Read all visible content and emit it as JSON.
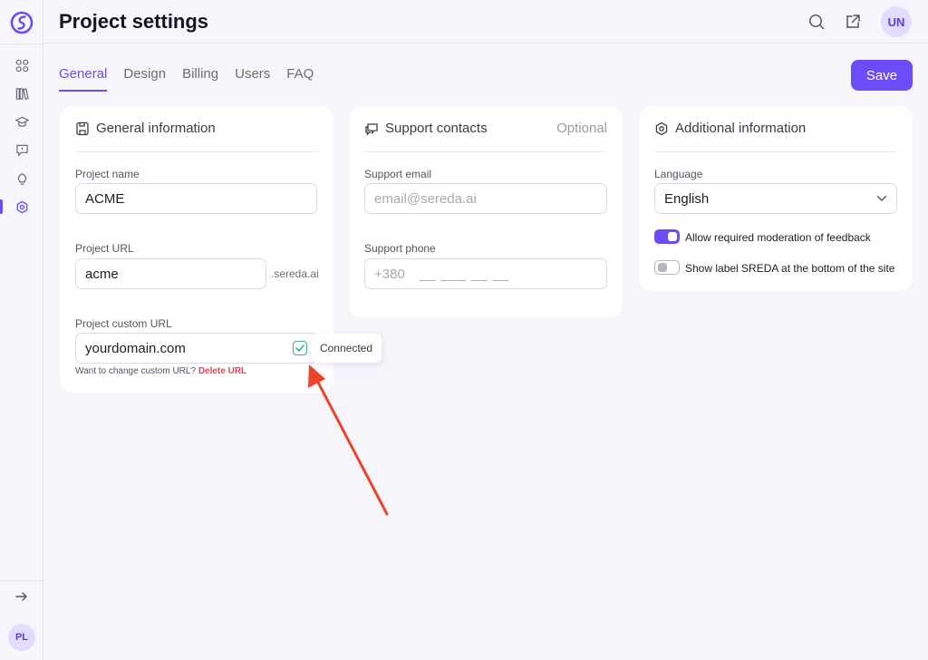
{
  "sidebar": {
    "nav_icons": [
      "dashboard-grid-icon",
      "library-books-icon",
      "graduation-cap-icon",
      "feedback-bubble-icon",
      "lightbulb-icon",
      "settings-hexagon-icon"
    ],
    "user_initials": "PL"
  },
  "header": {
    "title": "Project settings",
    "user_initials": "UN"
  },
  "tabs": [
    {
      "label": "General",
      "active": true
    },
    {
      "label": "Design",
      "active": false
    },
    {
      "label": "Billing",
      "active": false
    },
    {
      "label": "Users",
      "active": false
    },
    {
      "label": "FAQ",
      "active": false
    }
  ],
  "save_label": "Save",
  "general": {
    "title": "General information",
    "project_name_label": "Project name",
    "project_name_value": "ACME",
    "project_url_label": "Project URL",
    "project_url_value": "acme",
    "project_url_suffix": ".sereda.ai",
    "custom_url_label": "Project custom URL",
    "custom_url_value": "yourdomain.com",
    "custom_url_status": "Connected",
    "hint_text": "Want to change custom URL?",
    "hint_link": "Delete URL"
  },
  "support": {
    "title": "Support contacts",
    "optional_label": "Optional",
    "email_label": "Support email",
    "email_placeholder": "email@sereda.ai",
    "phone_label": "Support phone",
    "phone_prefix": "+380",
    "phone_mask": "__ ___ __ __"
  },
  "additional": {
    "title": "Additional information",
    "language_label": "Language",
    "language_value": "English",
    "toggle_moderation_label": "Allow required moderation of feedback",
    "toggle_moderation_on": true,
    "toggle_sreda_label": "Show label SREDA at the bottom of the site",
    "toggle_sreda_on": false
  },
  "colors": {
    "accent": "#6b4cf6",
    "success": "#36b37e",
    "danger": "#e0455b",
    "annotation_arrow": "#e8452c"
  }
}
